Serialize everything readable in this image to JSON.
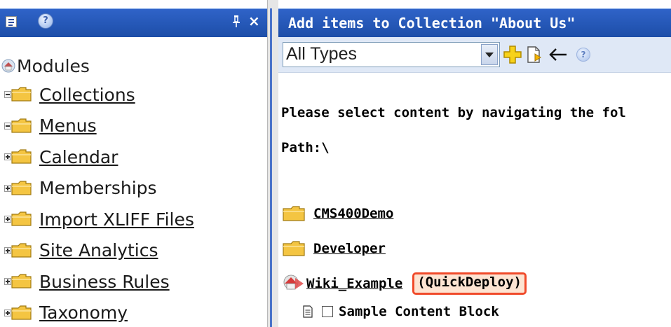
{
  "left_panel": {
    "header_icons": [
      "tree-view-icon",
      "help-icon",
      "pin-icon",
      "close-icon"
    ],
    "pin_glyph": "",
    "close_glyph": "×",
    "help_glyph": "?",
    "root": {
      "label": "Modules",
      "icon": "modules-house-icon"
    },
    "items": [
      {
        "label": "Collections",
        "expander": "minus",
        "link": true
      },
      {
        "label": "Menus",
        "expander": "minus",
        "link": true
      },
      {
        "label": "Calendar",
        "expander": "plus",
        "link": true
      },
      {
        "label": "Memberships",
        "expander": "plus",
        "link": false
      },
      {
        "label": "Import XLIFF Files",
        "expander": "plus",
        "link": true
      },
      {
        "label": "Site Analytics",
        "expander": "plus",
        "link": true
      },
      {
        "label": "Business Rules",
        "expander": "plus",
        "link": true
      },
      {
        "label": "Taxonomy",
        "expander": "plus",
        "link": true
      }
    ]
  },
  "right_panel": {
    "title": "Add items to Collection \"About Us\"",
    "toolbar": {
      "type_select": {
        "value": "All Types"
      },
      "icons": [
        "add-icon",
        "new-content-icon",
        "back-arrow-icon",
        "help-icon"
      ],
      "back_glyph": "←",
      "help_glyph": "?"
    },
    "instruction": "Please select content by navigating the fol",
    "path": "Path:\\",
    "folders": [
      {
        "label": "CMS400Demo"
      },
      {
        "label": "Developer"
      }
    ],
    "wiki": {
      "label": "Wiki_Example",
      "badge": "(QuickDeploy)"
    },
    "content_item": {
      "label": "Sample Content Block",
      "checked": false
    }
  },
  "colors": {
    "header_blue": "#2a5cbf",
    "toolbar_bg": "#dfe8f6",
    "folder_yellow": "#f4c542",
    "quickdeploy_border": "#f04a2a"
  }
}
